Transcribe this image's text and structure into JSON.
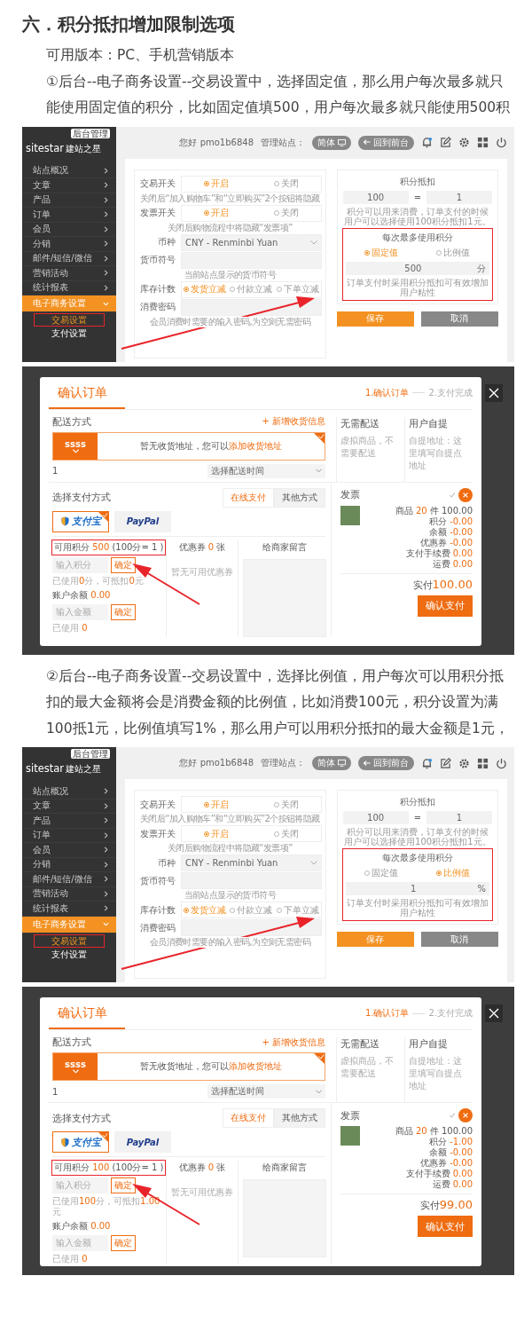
{
  "heading": "六．积分抵扣增加限制选项",
  "blocks": [
    {
      "kind": "paragraph",
      "text": "可用版本：PC、手机营销版本"
    },
    {
      "kind": "paragraph",
      "text": "①后台--电子商务设置--交易设置中，选择固定值，那么用户每次最多就只能使用固定值的积分，比如固定值填500，用户每次最多就只能使用500积"
    },
    {
      "kind": "admin_screenshot",
      "logo": "sitestar",
      "logo_badge": "后台管理",
      "logo_sub": "建站之星",
      "greeting": "您好 pmo1b6848",
      "site_label": "管理站点：",
      "lang_button": "简体",
      "front_button": "回到前台",
      "menu": [
        {
          "label": "站点概况",
          "expanded": false
        },
        {
          "label": "文章",
          "expanded": false
        },
        {
          "label": "产品",
          "expanded": false
        },
        {
          "label": "订单",
          "expanded": false
        },
        {
          "label": "会员",
          "expanded": false
        },
        {
          "label": "分销",
          "expanded": false
        },
        {
          "label": "邮件/短信/微信",
          "expanded": false
        },
        {
          "label": "营销活动",
          "expanded": false
        },
        {
          "label": "统计报表",
          "expanded": false
        },
        {
          "label": "电子商务设置",
          "expanded": true,
          "children": [
            {
              "label": "交易设置",
              "selected": true
            },
            {
              "label": "支付设置",
              "selected": false
            }
          ]
        }
      ],
      "form": [
        {
          "kind": "radio",
          "label": "交易开关",
          "options": [
            {
              "label": "开启",
              "selected": true
            },
            {
              "label": "关闭",
              "selected": false
            }
          ],
          "hint": "关闭后“加入购物车”和“立即购买”2个按钮将隐藏"
        },
        {
          "kind": "radio",
          "label": "发票开关",
          "options": [
            {
              "label": "开启",
              "selected": true
            },
            {
              "label": "关闭",
              "selected": false
            }
          ],
          "hint": "关闭后购物流程中将隐藏“发票项”"
        },
        {
          "kind": "select",
          "label": "币种",
          "value": "CNY - Renminbi Yuan"
        },
        {
          "kind": "input",
          "label": "货币符号",
          "hint": "当前站点显示的货币符号"
        },
        {
          "kind": "radio",
          "label": "库存计数",
          "options": [
            {
              "label": "发货立减",
              "selected": true
            },
            {
              "label": "付款立减",
              "selected": false
            },
            {
              "label": "下单立减",
              "selected": false
            }
          ]
        },
        {
          "kind": "input",
          "label": "消费密码",
          "hint": "会员消费时需要的输入密码,为空则无需密码"
        }
      ],
      "points": {
        "title": "积分抵扣",
        "points_value": "100",
        "equals": "=",
        "money_value": "1",
        "hint": "积分可以用来消费，订单支付的时候用户可以选择使用100积分抵扣1元。",
        "limit_title": "每次最多使用积分",
        "limit_options": [
          {
            "label": "固定值",
            "selected": true
          },
          {
            "label": "比例值",
            "selected": false
          }
        ],
        "limit_value": "500",
        "limit_unit": "分",
        "limit_hint": "订单支付时采用积分抵扣可有效增加用户粘性"
      },
      "buttons": [
        {
          "label": "保存",
          "kind": "primary"
        },
        {
          "label": "取消",
          "kind": "secondary"
        }
      ]
    },
    {
      "kind": "order_dialog",
      "title": "确认订单",
      "steps": [
        {
          "label": "1.确认订单",
          "selected": true
        },
        {
          "label": "2.支付完成",
          "selected": false
        }
      ],
      "shipping": {
        "title": "配送方式",
        "add_link": "+ 新增收货信息",
        "method": "ssss",
        "empty_text": "暂无收货地址，您可以",
        "address_link": "添加收货地址",
        "quantity": "1",
        "time_select": "选择配送时间"
      },
      "delivery_options": [
        {
          "title": "无需配送",
          "desc": "虚拟商品，不需要配送"
        },
        {
          "title": "用户自提",
          "desc": "自提地址：这里填写自提点地址"
        }
      ],
      "payment": {
        "title": "选择支付方式",
        "tabs": [
          {
            "label": "在线支付",
            "selected": true
          },
          {
            "label": "其他方式",
            "selected": false
          }
        ],
        "methods": [
          {
            "kind": "alipay",
            "label": "支付宝",
            "selected": true
          },
          {
            "kind": "paypal",
            "label": "PayPal",
            "selected": false
          }
        ]
      },
      "points": {
        "label": "可用积分",
        "value": "500",
        "rate": "(100分= 1 )",
        "placeholder": "输入积分",
        "button": "确定",
        "note": [
          "已使用",
          "0",
          "分，可抵扣",
          "0",
          "元"
        ]
      },
      "balance": {
        "label": "账户余额",
        "value": "0.00",
        "placeholder": "输入金额",
        "button": "确定",
        "used_label": "已使用",
        "used_value": "0"
      },
      "coupon": {
        "label": "优惠券",
        "count": "0",
        "unit": "张",
        "empty": "暂无可用优惠券"
      },
      "message": {
        "label": "给商家留言"
      },
      "invoice": {
        "title": "发票",
        "on": false
      },
      "summary": [
        {
          "label": "商品",
          "count": "20",
          "unit": "件",
          "value": "100.00"
        },
        {
          "label": "积分",
          "value": "-0.00"
        },
        {
          "label": "余额",
          "value": "-0.00"
        },
        {
          "label": "优惠券",
          "value": "-0.00"
        },
        {
          "label": "支付手续费",
          "value": "0.00"
        },
        {
          "label": "运费",
          "value": "0.00"
        }
      ],
      "total_label": "实付",
      "total": "100.00",
      "pay_button": "确认支付"
    },
    {
      "kind": "paragraph",
      "text": "②后台--电子商务设置--交易设置中，选择比例值，用户每次可以用积分抵扣的最大金额将会是消费金额的比例值，比如消费100元，积分设置为满100抵1元，比例值填写1%，那么用户可以用积分抵扣的最大金额是1元，"
    },
    {
      "kind": "admin_screenshot",
      "logo": "sitestar",
      "logo_badge": "后台管理",
      "logo_sub": "建站之星",
      "greeting": "您好 pmo1b6848",
      "site_label": "管理站点：",
      "lang_button": "简体",
      "front_button": "回到前台",
      "menu": [
        {
          "label": "站点概况",
          "expanded": false
        },
        {
          "label": "文章",
          "expanded": false
        },
        {
          "label": "产品",
          "expanded": false
        },
        {
          "label": "订单",
          "expanded": false
        },
        {
          "label": "会员",
          "expanded": false
        },
        {
          "label": "分销",
          "expanded": false
        },
        {
          "label": "邮件/短信/微信",
          "expanded": false
        },
        {
          "label": "营销活动",
          "expanded": false
        },
        {
          "label": "统计报表",
          "expanded": false
        },
        {
          "label": "电子商务设置",
          "expanded": true,
          "children": [
            {
              "label": "交易设置",
              "selected": true
            },
            {
              "label": "支付设置",
              "selected": false
            }
          ]
        }
      ],
      "form": [
        {
          "kind": "radio",
          "label": "交易开关",
          "options": [
            {
              "label": "开启",
              "selected": true
            },
            {
              "label": "关闭",
              "selected": false
            }
          ],
          "hint": "关闭后“加入购物车”和“立即购买”2个按钮将隐藏"
        },
        {
          "kind": "radio",
          "label": "发票开关",
          "options": [
            {
              "label": "开启",
              "selected": true
            },
            {
              "label": "关闭",
              "selected": false
            }
          ],
          "hint": "关闭后购物流程中将隐藏“发票项”"
        },
        {
          "kind": "select",
          "label": "币种",
          "value": "CNY - Renminbi Yuan"
        },
        {
          "kind": "input",
          "label": "货币符号",
          "hint": "当前站点显示的货币符号"
        },
        {
          "kind": "radio",
          "label": "库存计数",
          "options": [
            {
              "label": "发货立减",
              "selected": true
            },
            {
              "label": "付款立减",
              "selected": false
            },
            {
              "label": "下单立减",
              "selected": false
            }
          ]
        },
        {
          "kind": "input",
          "label": "消费密码",
          "hint": "会员消费时需要的输入密码,为空则无需密码"
        }
      ],
      "points": {
        "title": "积分抵扣",
        "points_value": "100",
        "equals": "=",
        "money_value": "1",
        "hint": "积分可以用来消费，订单支付的时候用户可以选择使用100积分抵扣1元。",
        "limit_title": "每次最多使用积分",
        "limit_options": [
          {
            "label": "固定值",
            "selected": false
          },
          {
            "label": "比例值",
            "selected": true
          }
        ],
        "limit_value": "1",
        "limit_unit": "%",
        "limit_hint": "订单支付时采用积分抵扣可有效增加用户粘性"
      },
      "buttons": [
        {
          "label": "保存",
          "kind": "primary"
        },
        {
          "label": "取消",
          "kind": "secondary"
        }
      ]
    },
    {
      "kind": "order_dialog",
      "title": "确认订单",
      "steps": [
        {
          "label": "1.确认订单",
          "selected": true
        },
        {
          "label": "2.支付完成",
          "selected": false
        }
      ],
      "shipping": {
        "title": "配送方式",
        "add_link": "+ 新增收货信息",
        "method": "ssss",
        "empty_text": "暂无收货地址，您可以",
        "address_link": "添加收货地址",
        "quantity": "1",
        "time_select": "选择配送时间"
      },
      "delivery_options": [
        {
          "title": "无需配送",
          "desc": "虚拟商品，不需要配送"
        },
        {
          "title": "用户自提",
          "desc": "自提地址：这里填写自提点地址"
        }
      ],
      "payment": {
        "title": "选择支付方式",
        "tabs": [
          {
            "label": "在线支付",
            "selected": true
          },
          {
            "label": "其他方式",
            "selected": false
          }
        ],
        "methods": [
          {
            "kind": "alipay",
            "label": "支付宝",
            "selected": true
          },
          {
            "kind": "paypal",
            "label": "PayPal",
            "selected": false
          }
        ]
      },
      "points": {
        "label": "可用积分",
        "value": "100",
        "rate": "(100分= 1 )",
        "placeholder": "输入积分",
        "button": "确定",
        "note": [
          "已使用",
          "100",
          "分，可抵扣",
          "1.00",
          "元"
        ]
      },
      "balance": {
        "label": "账户余额",
        "value": "0.00",
        "placeholder": "输入金额",
        "button": "确定",
        "used_label": "已使用",
        "used_value": "0"
      },
      "coupon": {
        "label": "优惠券",
        "count": "0",
        "unit": "张",
        "empty": "暂无可用优惠券"
      },
      "message": {
        "label": "给商家留言"
      },
      "invoice": {
        "title": "发票",
        "on": false
      },
      "summary": [
        {
          "label": "商品",
          "count": "20",
          "unit": "件",
          "value": "100.00"
        },
        {
          "label": "积分",
          "value": "-1.00"
        },
        {
          "label": "余额",
          "value": "-0.00"
        },
        {
          "label": "优惠券",
          "value": "-0.00"
        },
        {
          "label": "支付手续费",
          "value": "0.00"
        },
        {
          "label": "运费",
          "value": "0.00"
        }
      ],
      "total_label": "实付",
      "total": "99.00",
      "pay_button": "确认支付"
    }
  ]
}
